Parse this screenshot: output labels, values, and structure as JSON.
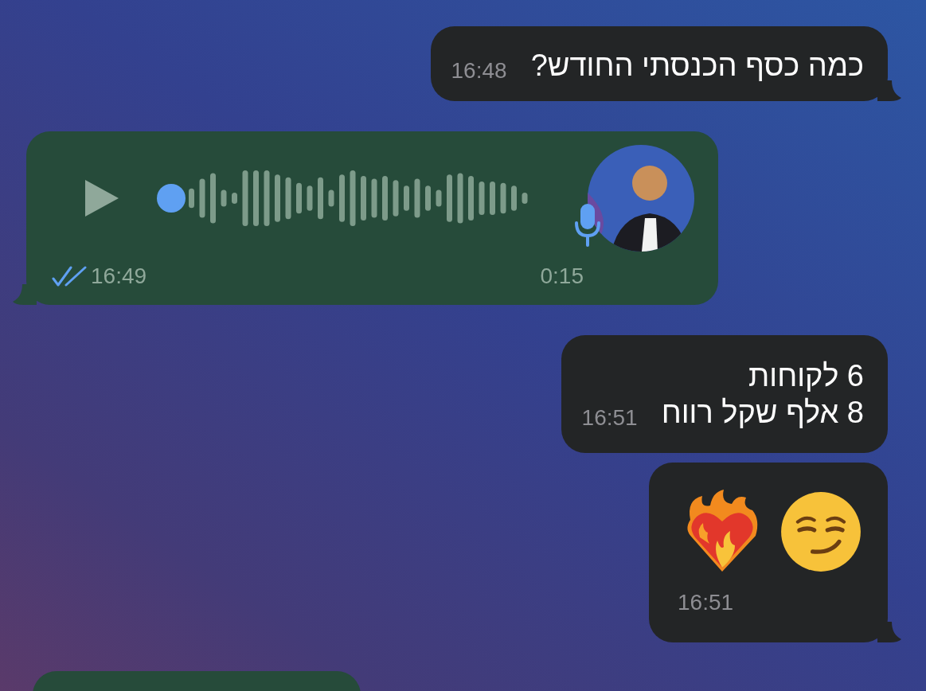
{
  "messages": [
    {
      "kind": "text",
      "incoming": false,
      "tail": true,
      "lines": [
        "כמה כסף הכנסתי החודש?"
      ],
      "time": "16:48"
    },
    {
      "kind": "voice",
      "incoming": true,
      "tail": true,
      "duration": "0:15",
      "time": "16:49",
      "read": true
    },
    {
      "kind": "text",
      "incoming": false,
      "tail": false,
      "lines": [
        "6 לקוחות",
        "8 אלף שקל רווח"
      ],
      "time": "16:51"
    },
    {
      "kind": "emoji",
      "incoming": false,
      "tail": true,
      "emojis": [
        {
          "kind": "smirk"
        },
        {
          "kind": "heart_on_fire"
        }
      ],
      "time": "16:51"
    },
    {
      "kind": "partial",
      "incoming": true
    }
  ]
}
